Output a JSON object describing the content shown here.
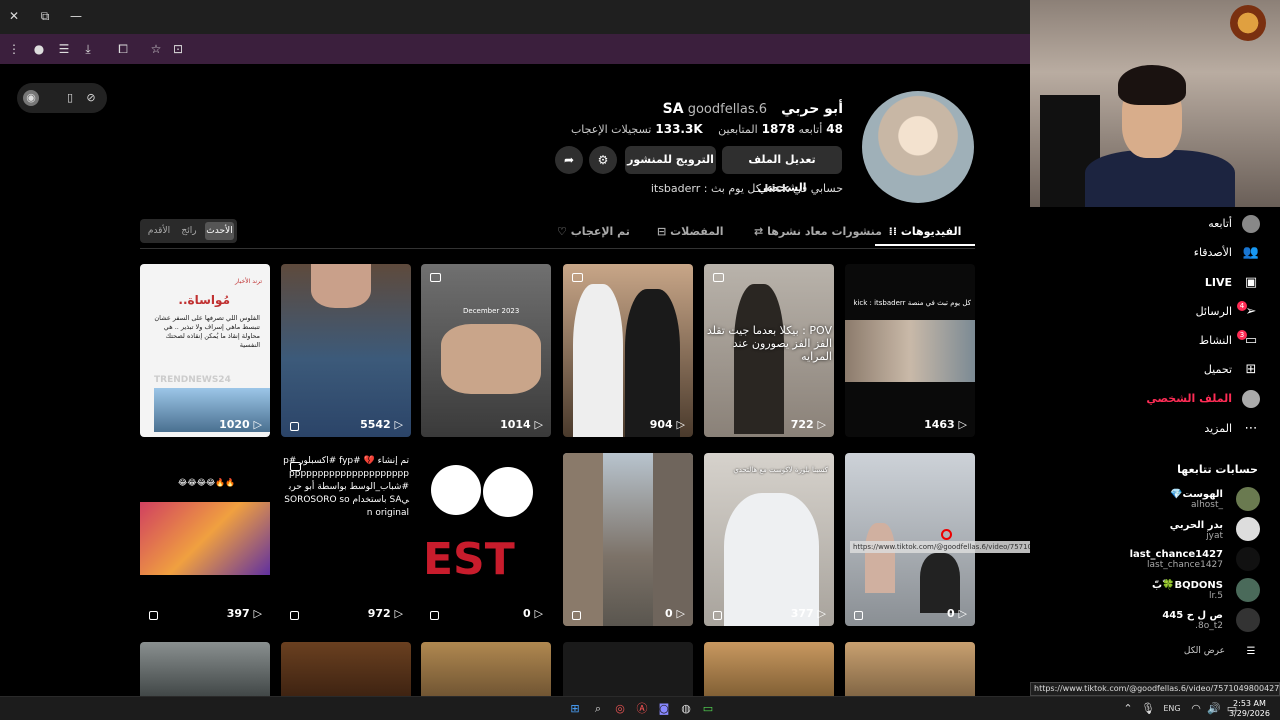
{
  "browser": {
    "url_status": "https://www.tiktok.com/@goodfellas.6/video/7571049800427228437"
  },
  "profile": {
    "display_name": "أبو حربيSA",
    "handle": "goodfellas.6",
    "following_label": "أتابعه",
    "following_count": "48",
    "followers_label": "المتابعين",
    "followers_count": "1878",
    "likes_label": "تسجيلات الإعجاب",
    "likes_count": "133.3K",
    "edit_button": "تعديل الملف الشخصي",
    "promote_button": "الترويج للمنشور",
    "bio_prefix": "حسابي في",
    "bio_kick": "kick",
    "bio_suffix": "كل يوم بث : itsbaderr"
  },
  "sort": {
    "latest": "الأحدث",
    "popular": "رائج",
    "oldest": "الأقدم"
  },
  "tabs": {
    "videos": "الفيديوهات",
    "reposts": "منشورات معاد نشرها",
    "favorites": "المفضلات",
    "liked": "تم الإعجاب"
  },
  "videos": [
    {
      "views": "1463",
      "caption": "كل يوم تبث في منصة kick : itsbaderr"
    },
    {
      "views": "722",
      "caption": "POV : بيكلا بعدما جيت تقلد الفز الفز يصورون عند المرايه"
    },
    {
      "views": "904"
    },
    {
      "views": "1014",
      "caption": "December 2023"
    },
    {
      "views": "5542"
    },
    {
      "views": "1020",
      "caption_title": "مُواساة..",
      "caption_body": "الفلوس اللي تصرفها على السفر عشان تنبسط ماهي إسراف ولا تبذير .. هي محاولة إنقاذ ما يُمكن إنقاذه لصحتك النفسية",
      "brand": "TRENDNEWS24",
      "tag": "ترند الأخبار"
    },
    {
      "views": "0"
    },
    {
      "views": "377",
      "caption": "كسبنا بلوزة لاكوست مع هالتحدي"
    },
    {
      "views": "0"
    },
    {
      "views": "0",
      "caption": "EST"
    },
    {
      "views": "972",
      "caption": "تم إنشاء 💔 #fyp #اكسبلور #pppppppppppppppppppppp #شباب_الوسط بواسطة أبو حربيSA باستخدام SOROSORO son original"
    },
    {
      "views": "397",
      "caption": "😂😂😂😂🔥🔥"
    }
  ],
  "sidebar": {
    "nav": [
      {
        "label": "أتابعه"
      },
      {
        "label": "الأصدقاء"
      },
      {
        "label": "LIVE"
      },
      {
        "label": "الرسائل",
        "badge": "4"
      },
      {
        "label": "النشاط",
        "badge": "3"
      },
      {
        "label": "تحميل"
      },
      {
        "label": "الملف الشخصي"
      },
      {
        "label": "المزيد"
      }
    ],
    "following_title": "حسابات تتابعها",
    "following": [
      {
        "name": "الهوست💎",
        "handle": "_alhost"
      },
      {
        "name": "بدر الحربي",
        "handle": "jyat"
      },
      {
        "name": "last_chance1427",
        "handle": "last_chance1427"
      },
      {
        "name": "BQDONS🍀ّبّ",
        "handle": "lr.5"
      },
      {
        "name": "ص ل ح 445",
        "handle": "8o_t2."
      }
    ],
    "see_all": "عرض الكل"
  },
  "taskbar": {
    "lang": "ENG",
    "time": "2:53 AM",
    "date": "3/29/2026"
  },
  "colors": {
    "accent": "#fe2c55",
    "titlebar": "#1f1f1f",
    "toolbar": "#3b1f3d"
  }
}
